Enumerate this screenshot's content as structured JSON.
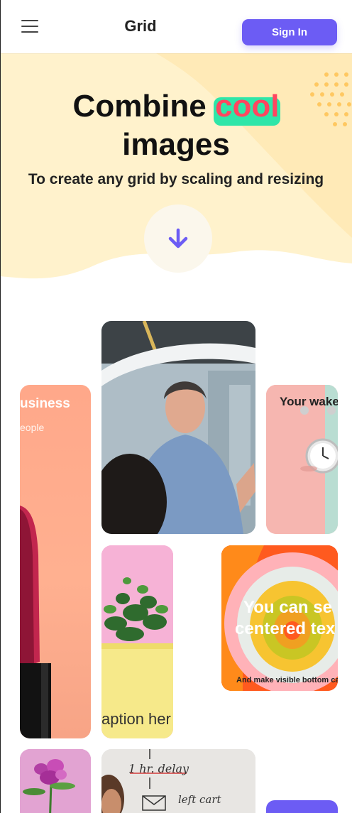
{
  "header": {
    "brand": "Grid",
    "signin_label": "Sign In"
  },
  "hero": {
    "title_before": "Combine ",
    "title_highlight": "cool",
    "title_line2": "images",
    "subtitle": "To create any grid by scaling and resizing"
  },
  "cards": {
    "business": {
      "title": "usiness",
      "sub": "eople"
    },
    "alarm": {
      "title": "Your wake"
    },
    "plant": {
      "caption": "aption her"
    },
    "centered": {
      "line1": "You can se",
      "line2": "centered tex",
      "bottom": "And make visible bottom capt"
    },
    "whiteboard": {
      "line1": "1 hr. delay",
      "line2": "left cart"
    }
  },
  "colors": {
    "accent": "#6c5cf4",
    "highlight": "#2ee6a8",
    "highlight_text": "#ff4560",
    "hero_bg": "#fff3cf"
  }
}
